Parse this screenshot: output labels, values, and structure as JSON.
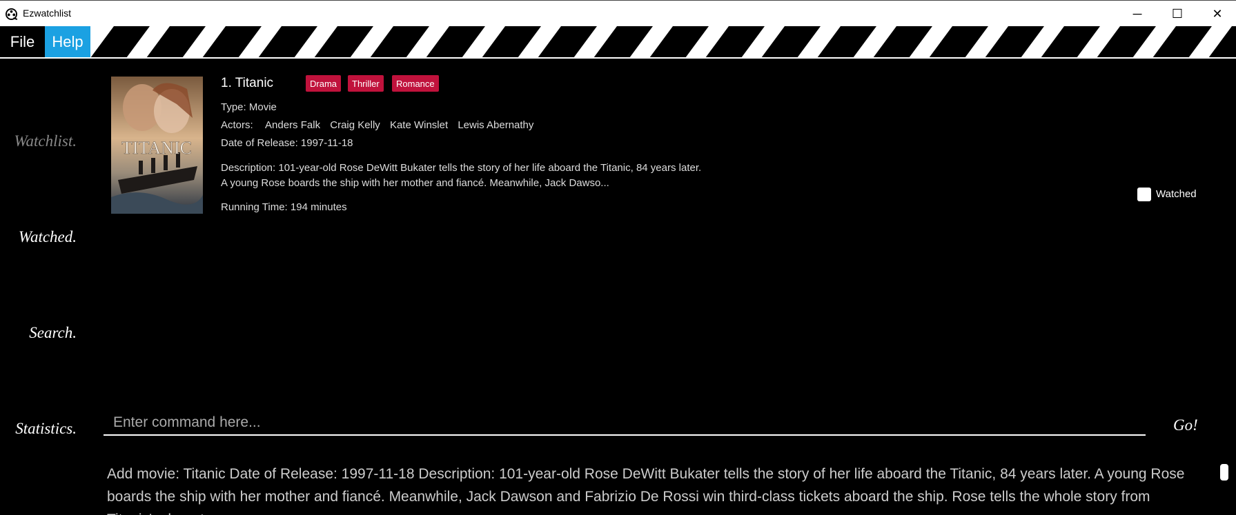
{
  "window": {
    "title": "Ezwatchlist",
    "logo_icon": "film-reel-icon",
    "buttons": {
      "minimize": "─",
      "maximize": "☐",
      "close": "✕"
    }
  },
  "menu": {
    "file": "File",
    "help": "Help",
    "accent": "#1ba1e2"
  },
  "nav": {
    "watchlist": "Watchlist.",
    "watched": "Watched.",
    "search": "Search.",
    "statistics": "Statistics."
  },
  "movie": {
    "index_title": "1.  Titanic",
    "genres": [
      "Drama",
      "Thriller",
      "Romance"
    ],
    "genre_color": "#c0123c",
    "type": "Type: Movie",
    "actors_label": "Actors:",
    "actors": [
      "Anders Falk",
      "Craig Kelly",
      "Kate Winslet",
      "Lewis Abernathy"
    ],
    "release": "Date of Release: 1997-11-18",
    "description": "Description: 101-year-old Rose DeWitt Bukater tells the story of her life aboard the Titanic, 84 years later. A young Rose boards the ship with her mother and fiancé. Meanwhile, Jack Dawso...",
    "running_time": "Running Time: 194 minutes",
    "poster_text": "TITANIC",
    "watched_label": "Watched",
    "watched": false
  },
  "command": {
    "placeholder": "Enter command here...",
    "go": "Go!"
  },
  "result": {
    "text": "Add movie: Titanic Date of Release: 1997-11-18 Description: 101-year-old Rose DeWitt Bukater tells the story of her life aboard the Titanic, 84 years later. A young Rose boards the ship with her mother and fiancé. Meanwhile, Jack Dawson and Fabrizio De Rossi win third-class tickets aboard the ship. Rose tells the whole story from Titanic's departure"
  }
}
